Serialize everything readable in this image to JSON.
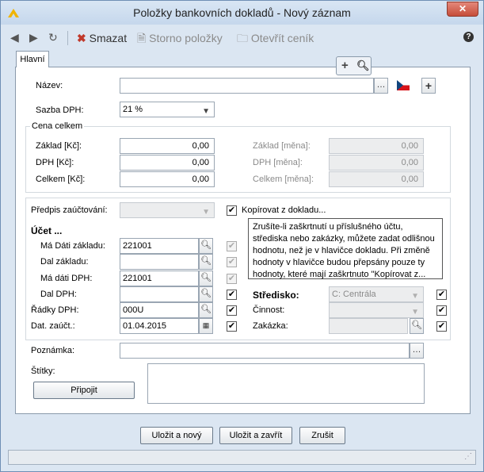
{
  "window": {
    "title": "Položky bankovních dokladů - Nový záznam",
    "close_label": "✕"
  },
  "toolbar": {
    "delete_label": "Smazat",
    "storno_label": "Storno položky",
    "open_price_label": "Otevřít ceník",
    "help_label": "?"
  },
  "tabs": [
    {
      "label": "Hlavní"
    }
  ],
  "form": {
    "name_label": "Název:",
    "name_value": "",
    "vat_rate_label": "Sazba DPH:",
    "vat_rate_value": "21 %",
    "price_group_label": "Cena celkem",
    "base_czk_label": "Základ [Kč]:",
    "base_czk_value": "0,00",
    "vat_czk_label": "DPH [Kč]:",
    "vat_czk_value": "0,00",
    "total_czk_label": "Celkem [Kč]:",
    "total_czk_value": "0,00",
    "base_cur_label": "Základ [měna]:",
    "base_cur_value": "0,00",
    "vat_cur_label": "DPH [měna]:",
    "vat_cur_value": "0,00",
    "total_cur_label": "Celkem [měna]:",
    "total_cur_value": "0,00",
    "posting_rule_label": "Předpis zaúčtování:",
    "copy_from_doc_label": "Kopírovat z dokladu...",
    "account_header": "Účet ...",
    "md_base_label": "Má Dáti základu:",
    "md_base_value": "221001",
    "d_base_label": "Dal základu:",
    "d_base_value": "",
    "md_vat_label": "Má dáti DPH:",
    "md_vat_value": "221001",
    "d_vat_label": "Dal DPH:",
    "d_vat_value": "",
    "vat_rows_label": "Řádky DPH:",
    "vat_rows_value": "000U",
    "posting_date_label": "Dat. zaúčt.:",
    "posting_date_value": "01.04.2015",
    "center_label": "Středisko:",
    "center_value": "C: Centrála",
    "activity_label": "Činnost:",
    "activity_value": "",
    "order_label": "Zakázka:",
    "order_value": "",
    "note_text": "Zrušíte-li zaškrtnutí u příslušného účtu, střediska nebo zakázky, můžete zadat odlišnou hodnotu, než je v hlavičce dokladu. Při změně hodnoty v hlavičce budou přepsány pouze ty hodnoty, které mají zaškrtnuto \"Kopírovat z...",
    "remark_label": "Poznámka:",
    "remark_value": "",
    "tags_label": "Štítky:",
    "attach_label": "Připojit"
  },
  "buttons": {
    "save_new": "Uložit a nový",
    "save_close": "Uložit a zavřít",
    "cancel": "Zrušit"
  },
  "status_text": "",
  "colors": {
    "window_bg": "#dbe6f2",
    "delete_icon": "#c0392b",
    "app_icon": "#f0b400"
  }
}
